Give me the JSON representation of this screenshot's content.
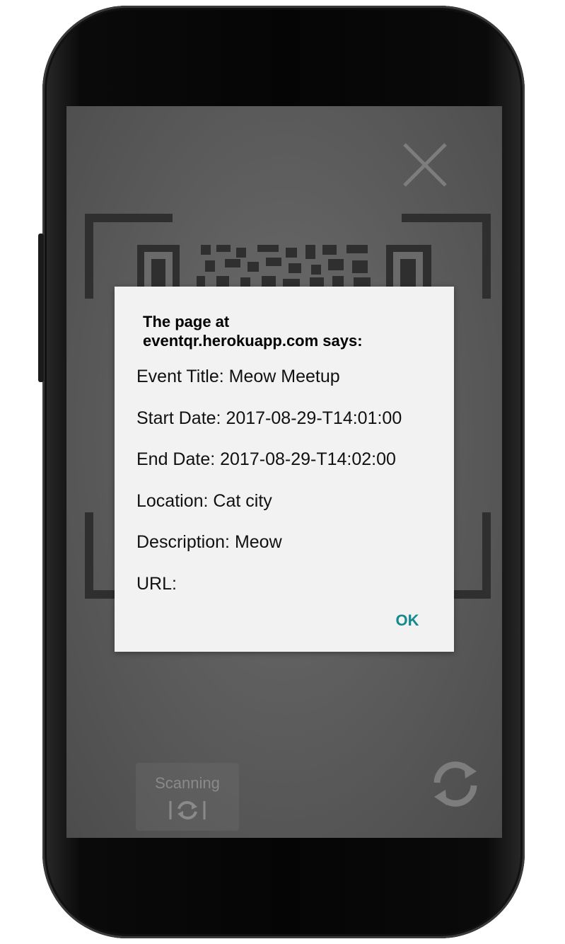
{
  "dialog": {
    "title_line1": "The page at",
    "title_line2": "eventqr.herokuapp.com says:",
    "lines": [
      "Event Title: Meow Meetup",
      "Start Date: 2017-08-29-T14:01:00",
      "End Date: 2017-08-29-T14:02:00",
      "Location: Cat city",
      "Description: Meow",
      "URL:"
    ],
    "ok_label": "OK"
  },
  "scanner": {
    "scanning_label": "Scanning",
    "close_icon": "close-icon",
    "refresh_icon": "refresh-icon",
    "scan_mode_icon": "camera-switch-icon"
  },
  "colors": {
    "accent": "#158a8e",
    "dialog_bg": "#f2f2f2",
    "screen_overlay": "#5e5e5e"
  }
}
